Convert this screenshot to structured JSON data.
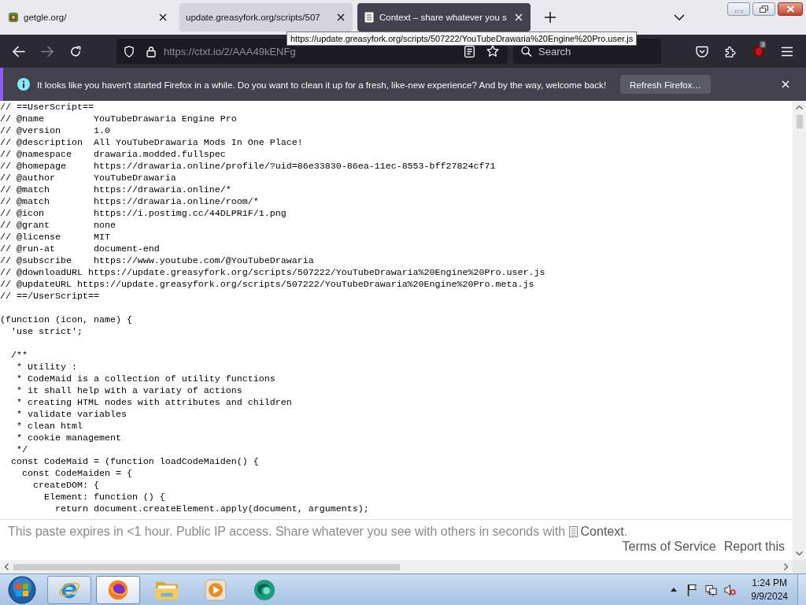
{
  "tabs": [
    {
      "title": "getgle.org/",
      "kind": "site",
      "selected": false,
      "hovered": false
    },
    {
      "title": "update.greasyfork.org/scripts/507",
      "kind": "plain",
      "selected": false,
      "hovered": true
    },
    {
      "title": "Context – share whatever you s",
      "kind": "document",
      "selected": true,
      "hovered": false
    }
  ],
  "tooltip": {
    "text": "https://update.greasyfork.org/scripts/507222/YouTubeDrawaria%20Engine%20Pro.user.js"
  },
  "toolbar": {
    "back_disabled": false,
    "forward_disabled": true,
    "url": "https://ctxt.io/2/AAA49kENFg",
    "search": {
      "placeholder": "Search"
    },
    "extension_badge": "3"
  },
  "notification": {
    "message": "It looks like you haven't started Firefox in a while. Do you want to clean it up for a fresh, like-new experience? And by the way, welcome back!",
    "button": "Refresh Firefox…"
  },
  "code": [
    [
      "// ==UserScript==",
      "// @name         YouTubeDrawaria Engine Pro",
      "// @version      1.0",
      "// @description  All YouTubeDrawaria Mods In One Place!",
      "// @namespace    drawaria.modded.fullspec",
      "// @homepage     https://drawaria.online/profile/?uid=86e33830-86ea-11ec-8553-bff27824cf71",
      "// @author       YouTubeDrawaria",
      "// @match        https://drawaria.online/*",
      "// @match        https://drawaria.online/room/*",
      "// @icon         https://i.postimg.cc/44DLPR1F/1.png",
      "// @grant        none",
      "// @license      MIT",
      "// @run-at       document-end",
      "// @subscribe    https://www.youtube.com/@YouTubeDrawaria",
      "// @downloadURL https://update.greasyfork.org/scripts/507222/YouTubeDrawaria%20Engine%20Pro.user.js",
      "// @updateURL https://update.greasyfork.org/scripts/507222/YouTubeDrawaria%20Engine%20Pro.meta.js",
      "// ==/UserScript=="
    ],
    [
      "(function (icon, name) {",
      "  'use strict';"
    ],
    [
      "  /**",
      "   * Utility :",
      "   * CodeMaid is a collection of utility functions",
      "   * it shall help with a variaty of actions",
      "   * creating HTML nodes with attributes and children",
      "   * validate variables",
      "   * clean html",
      "   * cookie management",
      "   */",
      "  const CodeMaid = (function loadCodeMaiden() {",
      "    const CodeMaiden = {",
      "      createDOM: {",
      "        Element: function () {",
      "          return document.createElement.apply(document, arguments);"
    ]
  ],
  "footer": {
    "note": "This paste expires in <1 hour. Public IP access. Share whatever you see with others in seconds with",
    "link": "Context",
    "after": ".",
    "links": [
      "Terms of Service",
      "Report this"
    ]
  },
  "taskbar": {
    "buttons": [
      {
        "kind": "letter",
        "running": true,
        "selected": false
      },
      {
        "kind": "globe",
        "running": true,
        "selected": true
      },
      {
        "kind": "folder",
        "running": false,
        "selected": false
      },
      {
        "kind": "player",
        "running": false,
        "selected": false
      },
      {
        "kind": "sphere",
        "running": false,
        "selected": false
      }
    ],
    "clock": {
      "time": "1:24 PM",
      "date": "9/9/2024"
    }
  }
}
